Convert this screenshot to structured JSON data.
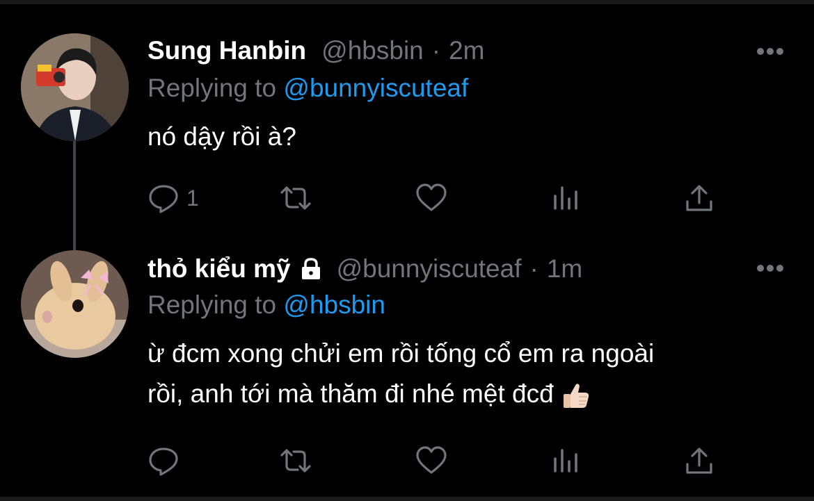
{
  "tweets": [
    {
      "name": "Sung Hanbin",
      "handle": "@hbsbin",
      "separator": "·",
      "time": "2m",
      "replying_prefix": "Replying to",
      "replying_to": "@bunnyiscuteaf",
      "text_lines": [
        "nó dậy rồi à?"
      ],
      "reply_count": "1",
      "avatar_icon": "person-avatar"
    },
    {
      "name": "thỏ kiểu mỹ",
      "handle": "@bunnyiscuteaf",
      "separator": "·",
      "time": "1m",
      "replying_prefix": "Replying to",
      "replying_to": "@hbsbin",
      "text_lines": [
        "ừ đcm xong chửi em rồi tống cổ em ra ngoài",
        "rồi, anh tới mà thăm đi nhé mệt đcđ"
      ],
      "reply_count": "",
      "avatar_icon": "bunny-avatar",
      "protected_icon": "lock-icon"
    }
  ],
  "colors": {
    "background": "#000000",
    "text": "#ffffff",
    "muted": "#71767b",
    "link": "#1d9bf0",
    "thread": "#3f4449"
  }
}
